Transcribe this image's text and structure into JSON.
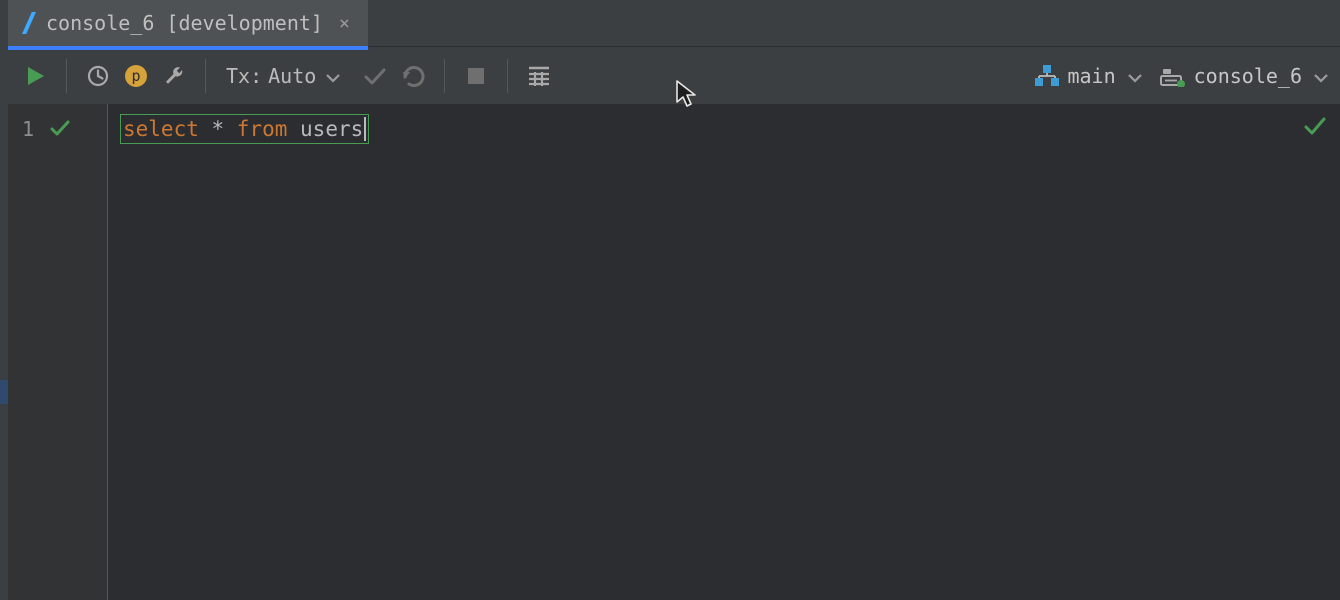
{
  "tab": {
    "title": "console_6 [development]",
    "close": "×"
  },
  "toolbar": {
    "tx_label": "Tx: ",
    "tx_value": "Auto",
    "play_icon": "play",
    "history_icon": "history",
    "p_badge": "p",
    "wrench_icon": "wrench",
    "commit_icon": "commit",
    "rollback_icon": "rollback",
    "stop_icon": "stop",
    "table_icon": "table"
  },
  "selectors": {
    "schema": "main",
    "session": "console_6"
  },
  "editor": {
    "line_no": "1",
    "code": {
      "kw1": "select",
      "star": " * ",
      "kw2": "from",
      "sp": " ",
      "ident": "users"
    }
  }
}
